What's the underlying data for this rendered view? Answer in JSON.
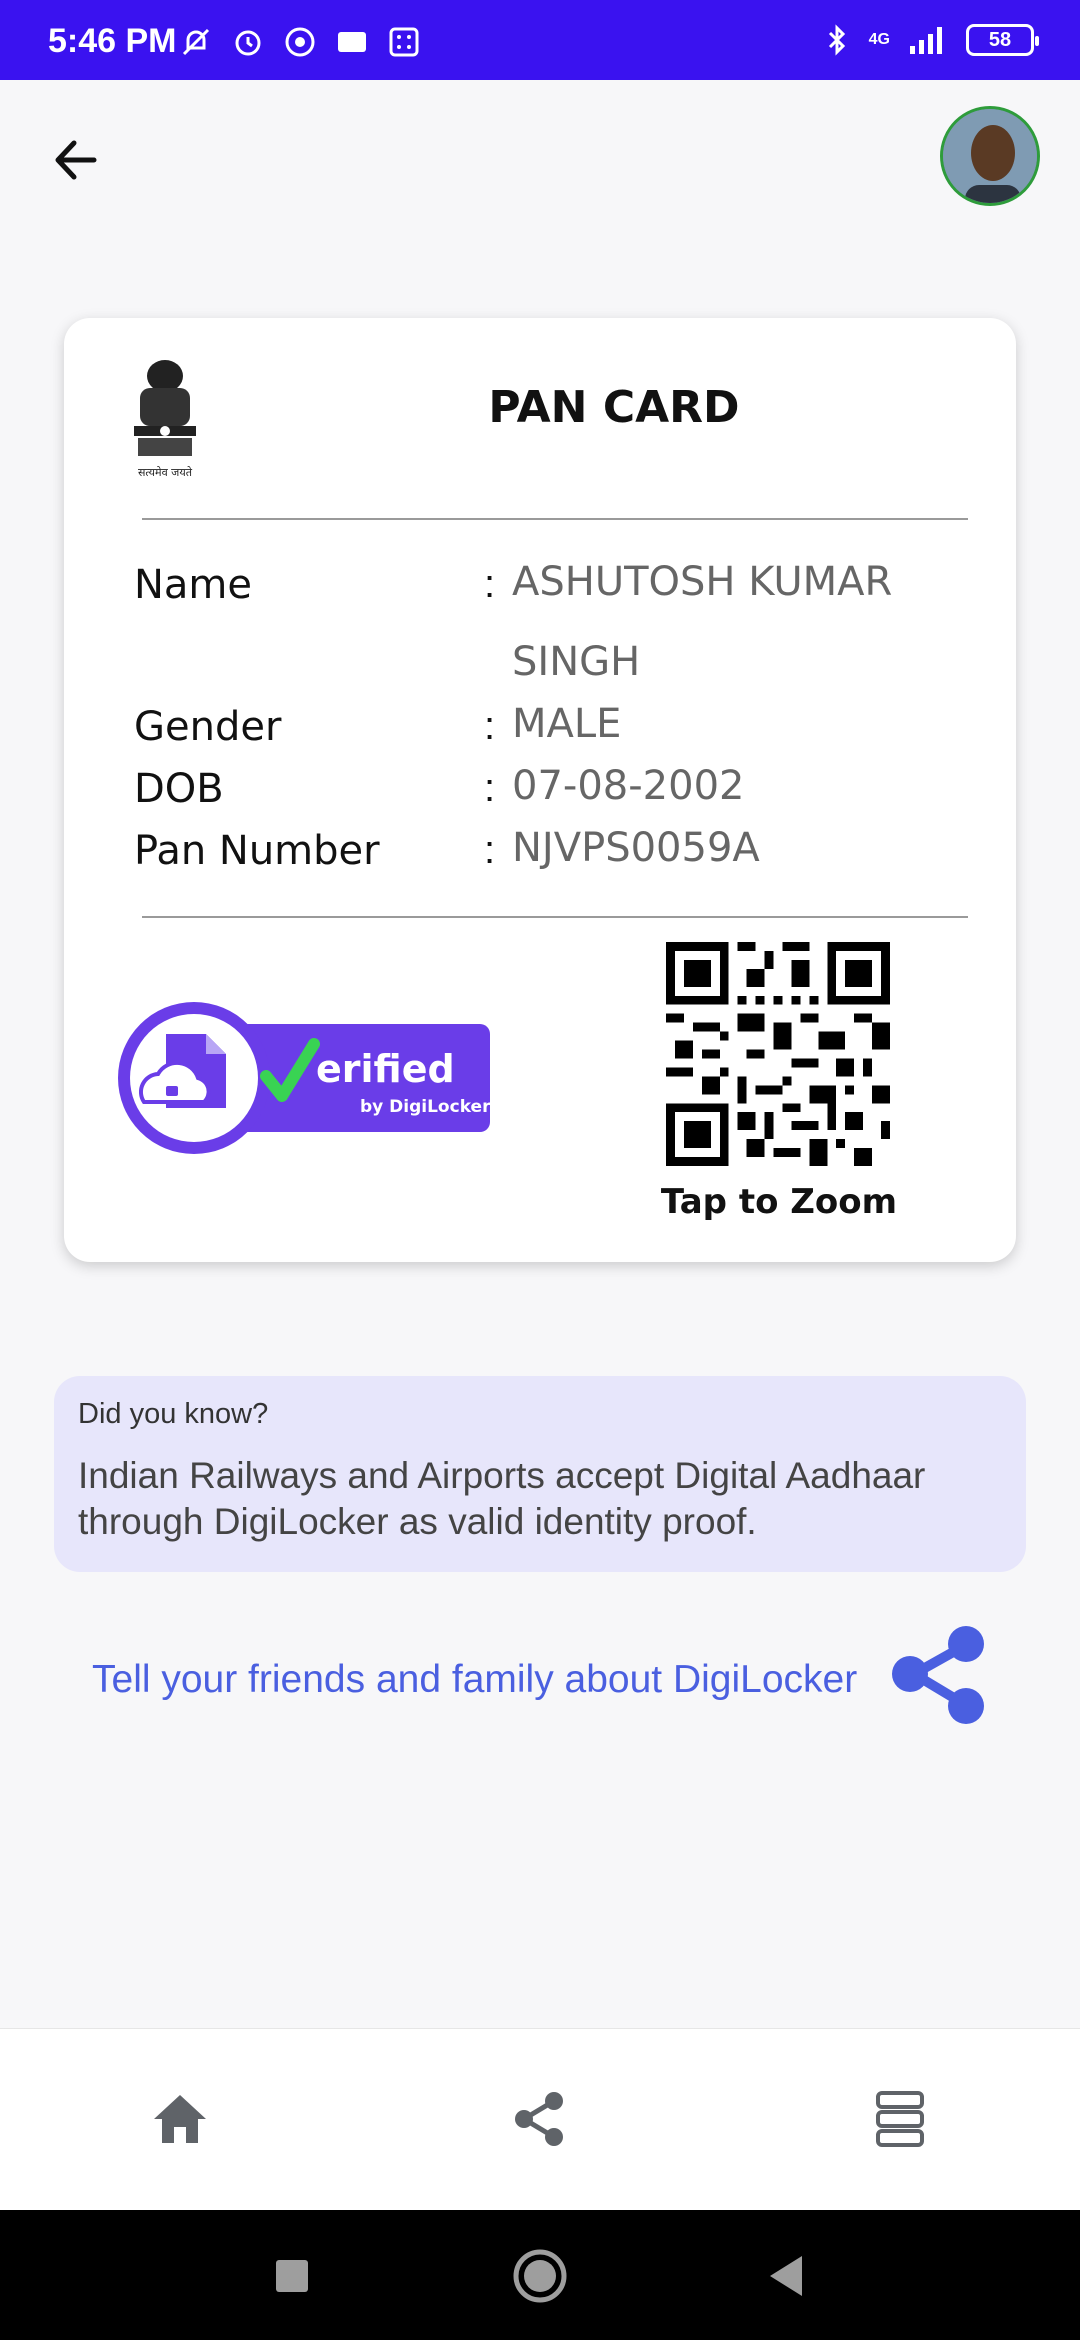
{
  "status_bar": {
    "time": "5:46 PM",
    "network": "4G",
    "battery": "58"
  },
  "card": {
    "title": "PAN CARD",
    "emblem_caption": "सत्यमेव जयते",
    "fields": [
      {
        "label": "Name",
        "value": "ASHUTOSH KUMAR SINGH"
      },
      {
        "label": "Gender",
        "value": "MALE"
      },
      {
        "label": "DOB",
        "value": "07-08-2002"
      },
      {
        "label": "Pan Number",
        "value": "NJVPS0059A"
      }
    ],
    "verified_badge": {
      "text": "erified",
      "sub": "by DigiLocker"
    },
    "qr_caption": "Tap to Zoom"
  },
  "info": {
    "title": "Did you know?",
    "text": "Indian Railways and Airports accept Digital Aadhaar through DigiLocker as valid identity proof."
  },
  "share": {
    "text": "Tell your friends and family about DigiLocker"
  },
  "colors": {
    "status_bar": "#3a12f0",
    "accent": "#6a3de8",
    "link": "#4a5fe0",
    "info_bg": "#e7e6fb"
  },
  "icons": {
    "back": "arrow-left-icon",
    "home": "home-icon",
    "share": "share-icon",
    "menu": "list-icon"
  }
}
